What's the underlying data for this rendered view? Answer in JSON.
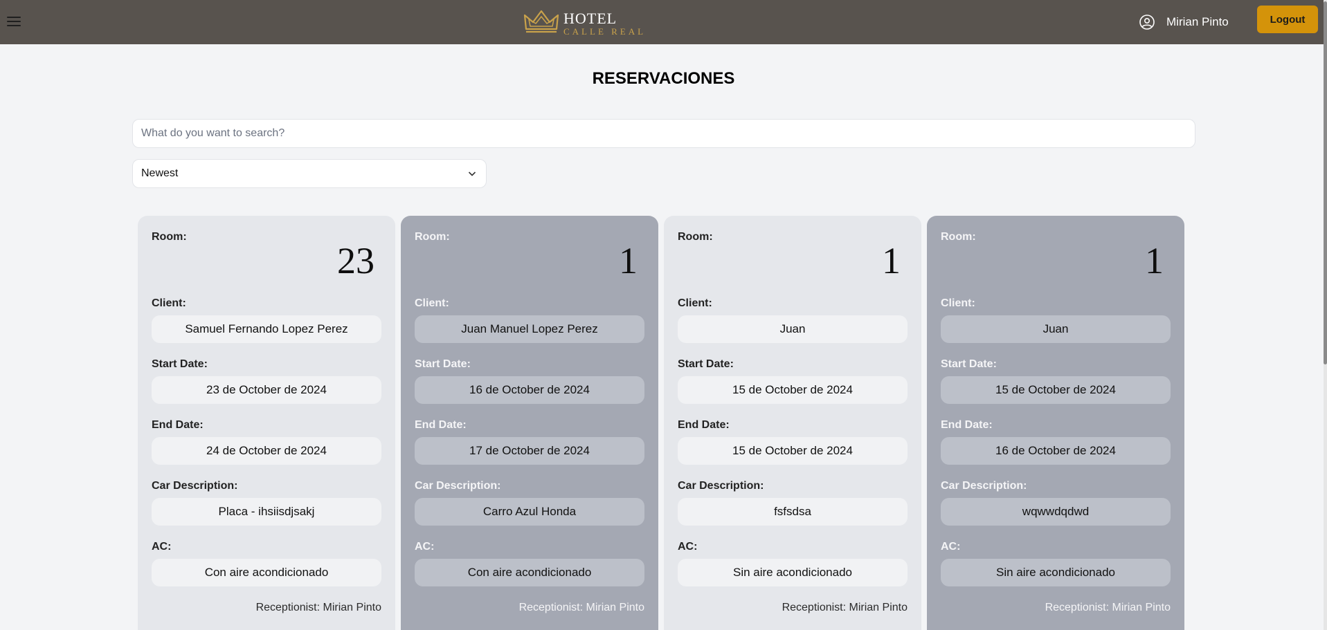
{
  "header": {
    "logo_title": "HOTEL",
    "logo_subtitle": "CALLE REAL",
    "user_name": "Mirian Pinto",
    "logout_label": "Logout"
  },
  "page": {
    "title": "RESERVACIONES",
    "search_placeholder": "What do you want to search?",
    "sort_selected": "Newest"
  },
  "labels": {
    "room": "Room:",
    "client": "Client:",
    "start_date": "Start Date:",
    "end_date": "End Date:",
    "car_description": "Car Description:",
    "ac": "AC:"
  },
  "reservations": [
    {
      "room": "23",
      "client": "Samuel Fernando Lopez Perez",
      "start_date": "23 de October de 2024",
      "end_date": "24 de October de 2024",
      "car_description": "Placa - ihsiisdjsakj",
      "ac": "Con aire acondicionado",
      "receptionist": "Receptionist: Mirian Pinto"
    },
    {
      "room": "1",
      "client": "Juan Manuel Lopez Perez",
      "start_date": "16 de October de 2024",
      "end_date": "17 de October de 2024",
      "car_description": "Carro Azul Honda",
      "ac": "Con aire acondicionado",
      "receptionist": "Receptionist: Mirian Pinto"
    },
    {
      "room": "1",
      "client": "Juan",
      "start_date": "15 de October de 2024",
      "end_date": "15 de October de 2024",
      "car_description": "fsfsdsa",
      "ac": "Sin aire acondicionado",
      "receptionist": "Receptionist: Mirian Pinto"
    },
    {
      "room": "1",
      "client": "Juan",
      "start_date": "15 de October de 2024",
      "end_date": "16 de October de 2024",
      "car_description": "wqwwdqdwd",
      "ac": "Sin aire acondicionado",
      "receptionist": "Receptionist: Mirian Pinto"
    }
  ],
  "icons": {
    "menu": "hamburger-menu-icon",
    "logo": "crown-icon",
    "user": "user-circle-icon",
    "sort": "chevron-down-icon"
  },
  "colors": {
    "topbar": "#58534e",
    "logout": "#d4930a",
    "card_light": "#e5e7eb",
    "card_dark": "#a4a8b3",
    "logo_gold": "#c9a24b"
  }
}
